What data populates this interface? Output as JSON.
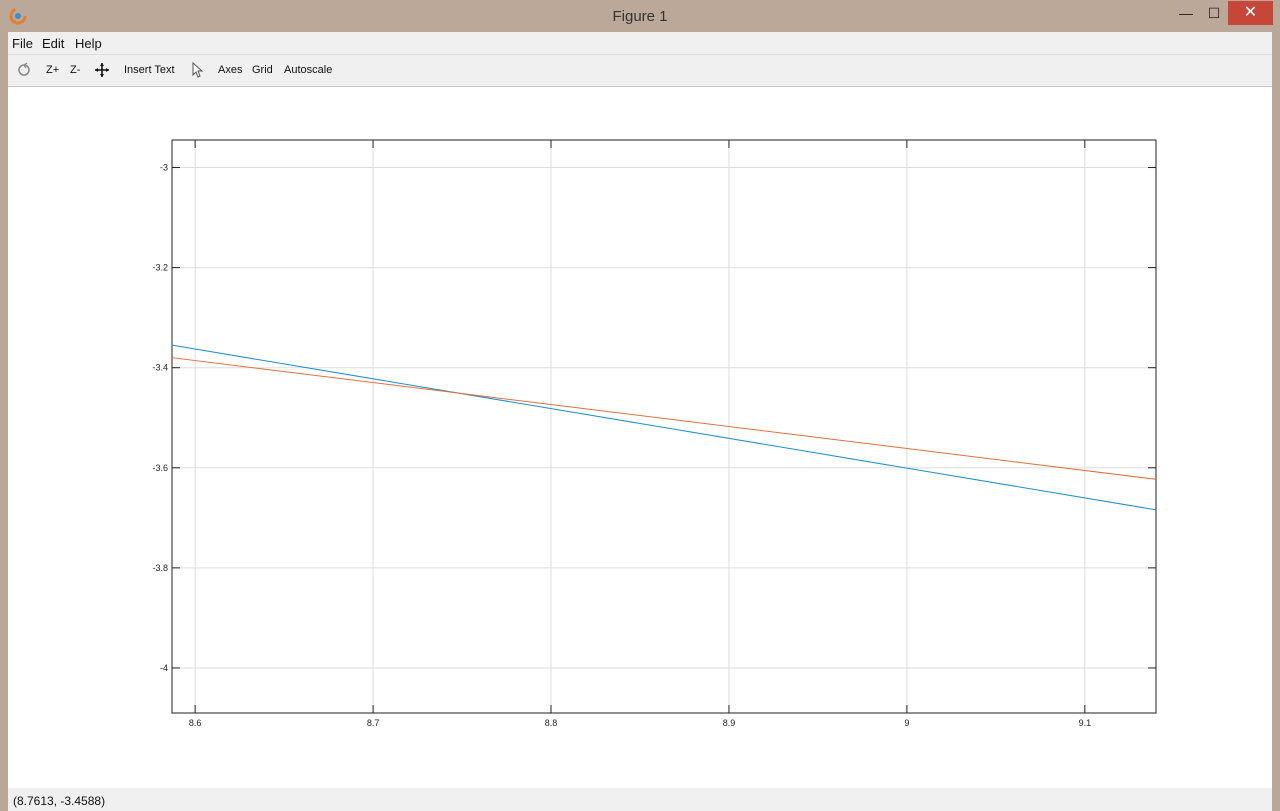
{
  "window": {
    "title": "Figure 1",
    "controls": {
      "minimize": "—",
      "maximize": "☐",
      "close": "✕"
    }
  },
  "menu": {
    "items": [
      {
        "label": "File"
      },
      {
        "label": "Edit"
      },
      {
        "label": "Help"
      }
    ]
  },
  "toolbar": {
    "zoom_in": "Z+",
    "zoom_out": "Z-",
    "insert_text": "Insert Text",
    "axes": "Axes",
    "grid": "Grid",
    "autoscale": "Autoscale",
    "icons": [
      "rotate-icon",
      "pan-icon",
      "select-pointer-icon"
    ]
  },
  "status": {
    "coordinates": "(8.7613, -3.4588)"
  },
  "chart_data": {
    "type": "line",
    "title": "",
    "xlabel": "",
    "ylabel": "",
    "xlim": [
      8.587,
      9.14
    ],
    "ylim": [
      -4.09,
      -2.945
    ],
    "xticks": [
      8.6,
      8.7,
      8.8,
      8.9,
      9.0,
      9.1
    ],
    "xtick_labels": [
      "8.6",
      "8.7",
      "8.8",
      "8.9",
      "9",
      "9.1"
    ],
    "yticks": [
      -3.0,
      -3.2,
      -3.4,
      -3.6,
      -3.8,
      -4.0
    ],
    "ytick_labels": [
      "-3",
      "-3.2",
      "-3.4",
      "-3.6",
      "-3.8",
      "-4"
    ],
    "grid": true,
    "series": [
      {
        "color": "#1f8fcf",
        "x": [
          8.587,
          9.14
        ],
        "y": [
          -3.355,
          -3.684
        ]
      },
      {
        "color": "#e2703a",
        "x": [
          8.587,
          9.14
        ],
        "y": [
          -3.38,
          -3.623
        ]
      }
    ]
  }
}
